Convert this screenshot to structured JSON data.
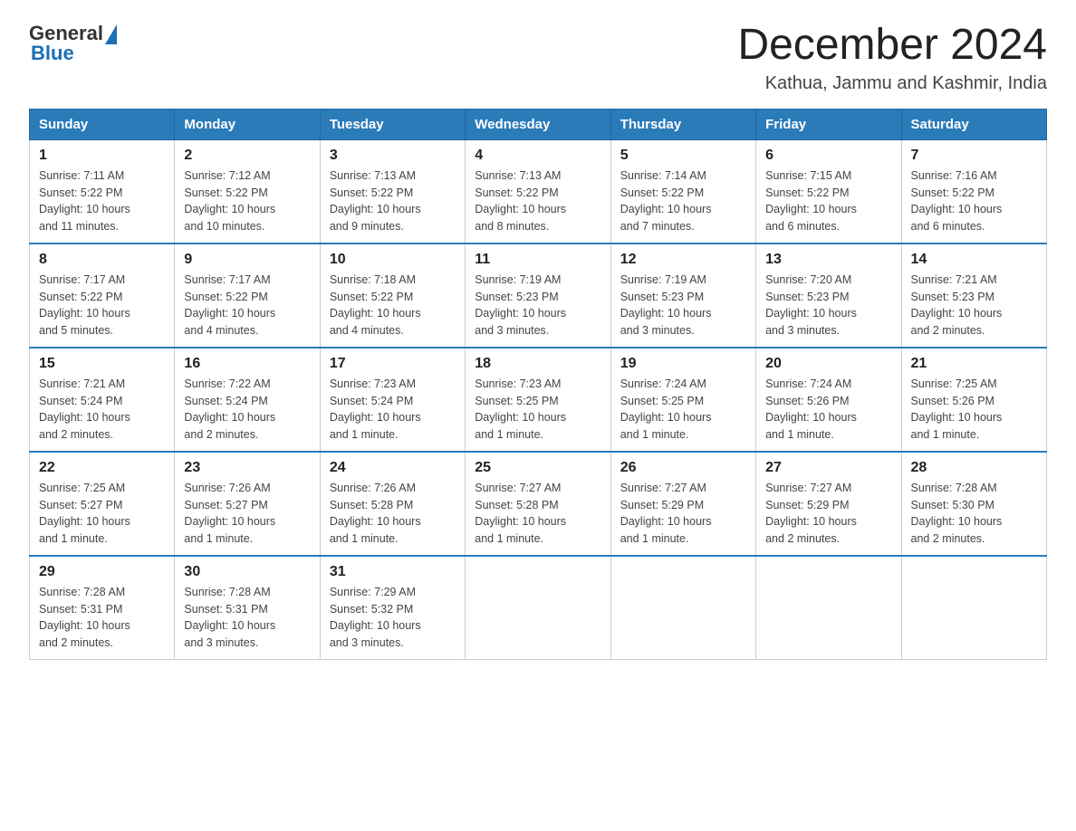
{
  "header": {
    "logo_text_general": "General",
    "logo_text_blue": "Blue",
    "title": "December 2024",
    "subtitle": "Kathua, Jammu and Kashmir, India"
  },
  "days_of_week": [
    "Sunday",
    "Monday",
    "Tuesday",
    "Wednesday",
    "Thursday",
    "Friday",
    "Saturday"
  ],
  "weeks": [
    [
      {
        "day": "1",
        "sunrise": "7:11 AM",
        "sunset": "5:22 PM",
        "daylight": "10 hours and 11 minutes."
      },
      {
        "day": "2",
        "sunrise": "7:12 AM",
        "sunset": "5:22 PM",
        "daylight": "10 hours and 10 minutes."
      },
      {
        "day": "3",
        "sunrise": "7:13 AM",
        "sunset": "5:22 PM",
        "daylight": "10 hours and 9 minutes."
      },
      {
        "day": "4",
        "sunrise": "7:13 AM",
        "sunset": "5:22 PM",
        "daylight": "10 hours and 8 minutes."
      },
      {
        "day": "5",
        "sunrise": "7:14 AM",
        "sunset": "5:22 PM",
        "daylight": "10 hours and 7 minutes."
      },
      {
        "day": "6",
        "sunrise": "7:15 AM",
        "sunset": "5:22 PM",
        "daylight": "10 hours and 6 minutes."
      },
      {
        "day": "7",
        "sunrise": "7:16 AM",
        "sunset": "5:22 PM",
        "daylight": "10 hours and 6 minutes."
      }
    ],
    [
      {
        "day": "8",
        "sunrise": "7:17 AM",
        "sunset": "5:22 PM",
        "daylight": "10 hours and 5 minutes."
      },
      {
        "day": "9",
        "sunrise": "7:17 AM",
        "sunset": "5:22 PM",
        "daylight": "10 hours and 4 minutes."
      },
      {
        "day": "10",
        "sunrise": "7:18 AM",
        "sunset": "5:22 PM",
        "daylight": "10 hours and 4 minutes."
      },
      {
        "day": "11",
        "sunrise": "7:19 AM",
        "sunset": "5:23 PM",
        "daylight": "10 hours and 3 minutes."
      },
      {
        "day": "12",
        "sunrise": "7:19 AM",
        "sunset": "5:23 PM",
        "daylight": "10 hours and 3 minutes."
      },
      {
        "day": "13",
        "sunrise": "7:20 AM",
        "sunset": "5:23 PM",
        "daylight": "10 hours and 3 minutes."
      },
      {
        "day": "14",
        "sunrise": "7:21 AM",
        "sunset": "5:23 PM",
        "daylight": "10 hours and 2 minutes."
      }
    ],
    [
      {
        "day": "15",
        "sunrise": "7:21 AM",
        "sunset": "5:24 PM",
        "daylight": "10 hours and 2 minutes."
      },
      {
        "day": "16",
        "sunrise": "7:22 AM",
        "sunset": "5:24 PM",
        "daylight": "10 hours and 2 minutes."
      },
      {
        "day": "17",
        "sunrise": "7:23 AM",
        "sunset": "5:24 PM",
        "daylight": "10 hours and 1 minute."
      },
      {
        "day": "18",
        "sunrise": "7:23 AM",
        "sunset": "5:25 PM",
        "daylight": "10 hours and 1 minute."
      },
      {
        "day": "19",
        "sunrise": "7:24 AM",
        "sunset": "5:25 PM",
        "daylight": "10 hours and 1 minute."
      },
      {
        "day": "20",
        "sunrise": "7:24 AM",
        "sunset": "5:26 PM",
        "daylight": "10 hours and 1 minute."
      },
      {
        "day": "21",
        "sunrise": "7:25 AM",
        "sunset": "5:26 PM",
        "daylight": "10 hours and 1 minute."
      }
    ],
    [
      {
        "day": "22",
        "sunrise": "7:25 AM",
        "sunset": "5:27 PM",
        "daylight": "10 hours and 1 minute."
      },
      {
        "day": "23",
        "sunrise": "7:26 AM",
        "sunset": "5:27 PM",
        "daylight": "10 hours and 1 minute."
      },
      {
        "day": "24",
        "sunrise": "7:26 AM",
        "sunset": "5:28 PM",
        "daylight": "10 hours and 1 minute."
      },
      {
        "day": "25",
        "sunrise": "7:27 AM",
        "sunset": "5:28 PM",
        "daylight": "10 hours and 1 minute."
      },
      {
        "day": "26",
        "sunrise": "7:27 AM",
        "sunset": "5:29 PM",
        "daylight": "10 hours and 1 minute."
      },
      {
        "day": "27",
        "sunrise": "7:27 AM",
        "sunset": "5:29 PM",
        "daylight": "10 hours and 2 minutes."
      },
      {
        "day": "28",
        "sunrise": "7:28 AM",
        "sunset": "5:30 PM",
        "daylight": "10 hours and 2 minutes."
      }
    ],
    [
      {
        "day": "29",
        "sunrise": "7:28 AM",
        "sunset": "5:31 PM",
        "daylight": "10 hours and 2 minutes."
      },
      {
        "day": "30",
        "sunrise": "7:28 AM",
        "sunset": "5:31 PM",
        "daylight": "10 hours and 3 minutes."
      },
      {
        "day": "31",
        "sunrise": "7:29 AM",
        "sunset": "5:32 PM",
        "daylight": "10 hours and 3 minutes."
      },
      null,
      null,
      null,
      null
    ]
  ],
  "labels": {
    "sunrise": "Sunrise:",
    "sunset": "Sunset:",
    "daylight": "Daylight:"
  }
}
